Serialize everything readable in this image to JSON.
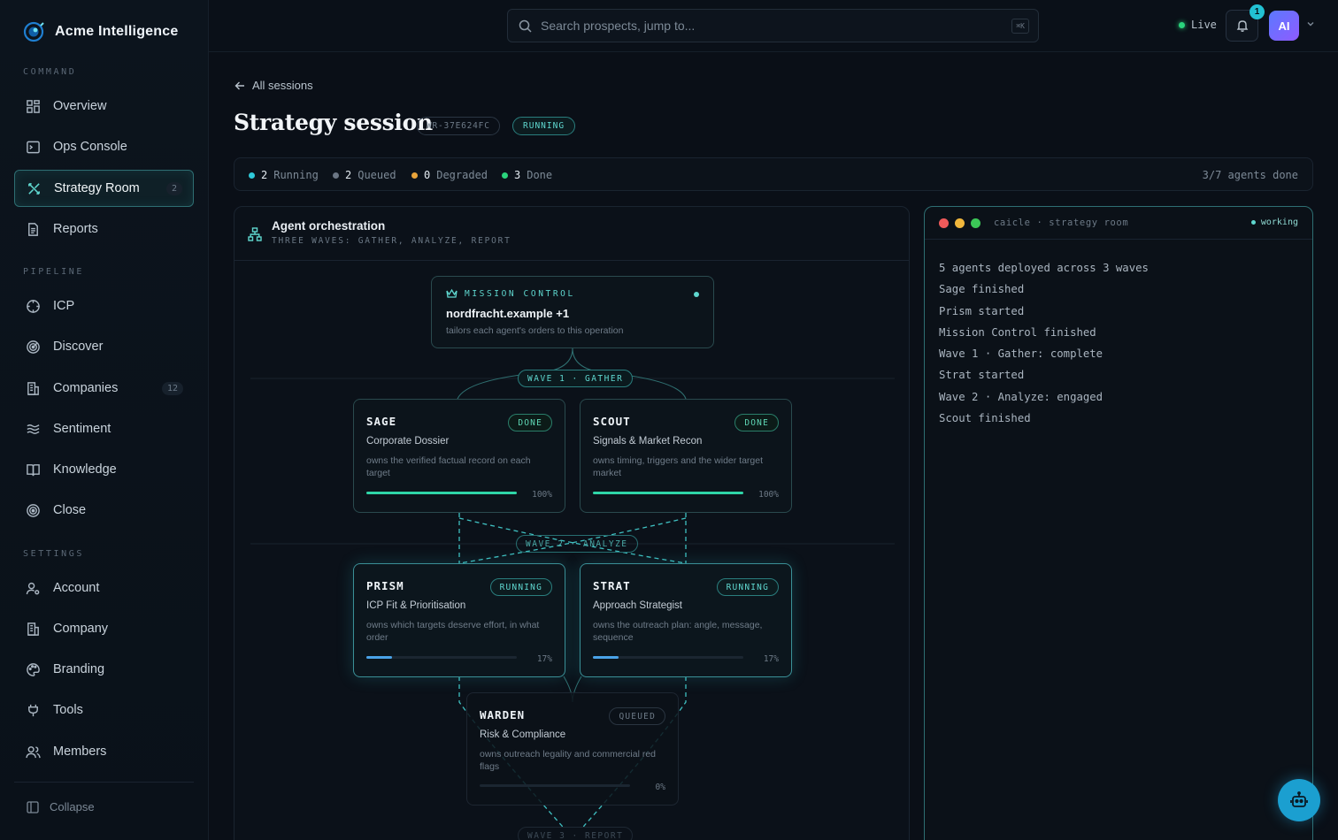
{
  "brand": {
    "name": "Acme Intelligence"
  },
  "sidebar": {
    "sections": {
      "command": "COMMAND",
      "pipeline": "PIPELINE",
      "settings": "SETTINGS"
    },
    "items": [
      {
        "label": "Overview",
        "icon": "grid-icon"
      },
      {
        "label": "Ops Console",
        "icon": "console-icon"
      },
      {
        "label": "Strategy Room",
        "icon": "strategy-icon",
        "badge": "2",
        "active": true
      },
      {
        "label": "Reports",
        "icon": "document-icon"
      },
      {
        "label": "ICP",
        "icon": "crosshair-icon"
      },
      {
        "label": "Discover",
        "icon": "radar-icon"
      },
      {
        "label": "Companies",
        "icon": "building-icon",
        "badge": "12"
      },
      {
        "label": "Sentiment",
        "icon": "waves-icon"
      },
      {
        "label": "Knowledge",
        "icon": "book-icon"
      },
      {
        "label": "Close",
        "icon": "target-icon"
      },
      {
        "label": "Account",
        "icon": "user-gear-icon"
      },
      {
        "label": "Company",
        "icon": "building-icon"
      },
      {
        "label": "Branding",
        "icon": "palette-icon"
      },
      {
        "label": "Tools",
        "icon": "plug-icon"
      },
      {
        "label": "Members",
        "icon": "users-icon"
      }
    ],
    "collapse_label": "Collapse"
  },
  "topbar": {
    "search_placeholder": "Search prospects, jump to...",
    "shortcut": "⌘K",
    "live_label": "Live",
    "notification_count": "1",
    "avatar_initials": "AI"
  },
  "page": {
    "back_label": "All sessions",
    "title": "Strategy session",
    "session_id": "WR-37E624FC",
    "status": "RUNNING"
  },
  "status_summary": {
    "running": {
      "count": "2",
      "label": "Running",
      "color": "#2ec9d9"
    },
    "queued": {
      "count": "2",
      "label": "Queued",
      "color": "#6b7684"
    },
    "degraded": {
      "count": "0",
      "label": "Degraded",
      "color": "#e8a33a"
    },
    "done": {
      "count": "3",
      "label": "Done",
      "color": "#2ad37c"
    },
    "agents_done": "3/7 agents done"
  },
  "orchestration": {
    "title": "Agent orchestration",
    "subtitle": "THREE WAVES: GATHER, ANALYZE, REPORT",
    "mission": {
      "label": "MISSION CONTROL",
      "target": "nordfracht.example +1",
      "description": "tailors each agent's orders to this operation"
    },
    "waves": {
      "w1": "WAVE 1 · GATHER",
      "w2": "WAVE 2 · ANALYZE",
      "w3": "WAVE 3 · REPORT"
    },
    "agents": {
      "sage": {
        "name": "SAGE",
        "role": "Corporate Dossier",
        "description": "owns the verified factual record on each target",
        "status": "DONE",
        "progress": 100,
        "progress_label": "100%"
      },
      "scout": {
        "name": "SCOUT",
        "role": "Signals & Market Recon",
        "description": "owns timing, triggers and the wider target market",
        "status": "DONE",
        "progress": 100,
        "progress_label": "100%"
      },
      "prism": {
        "name": "PRISM",
        "role": "ICP Fit & Prioritisation",
        "description": "owns which targets deserve effort, in what order",
        "status": "RUNNING",
        "progress": 17,
        "progress_label": "17%"
      },
      "strat": {
        "name": "STRAT",
        "role": "Approach Strategist",
        "description": "owns the outreach plan: angle, message, sequence",
        "status": "RUNNING",
        "progress": 17,
        "progress_label": "17%"
      },
      "warden": {
        "name": "WARDEN",
        "role": "Risk & Compliance",
        "description": "owns outreach legality and commercial red flags",
        "status": "QUEUED",
        "progress": 0,
        "progress_label": "0%"
      }
    }
  },
  "terminal": {
    "title": "caicle · strategy room",
    "status": "working",
    "lines": [
      "5 agents deployed across 3 waves",
      "Sage finished",
      "Prism started",
      "Mission Control finished",
      "Wave 1 · Gather: complete",
      "Strat started",
      "Wave 2 · Analyze: engaged",
      "Scout finished"
    ]
  },
  "colors": {
    "accent": "#5fd7cf",
    "progress_done": "#2fd6a8",
    "progress_running": "#4aa3e8"
  }
}
